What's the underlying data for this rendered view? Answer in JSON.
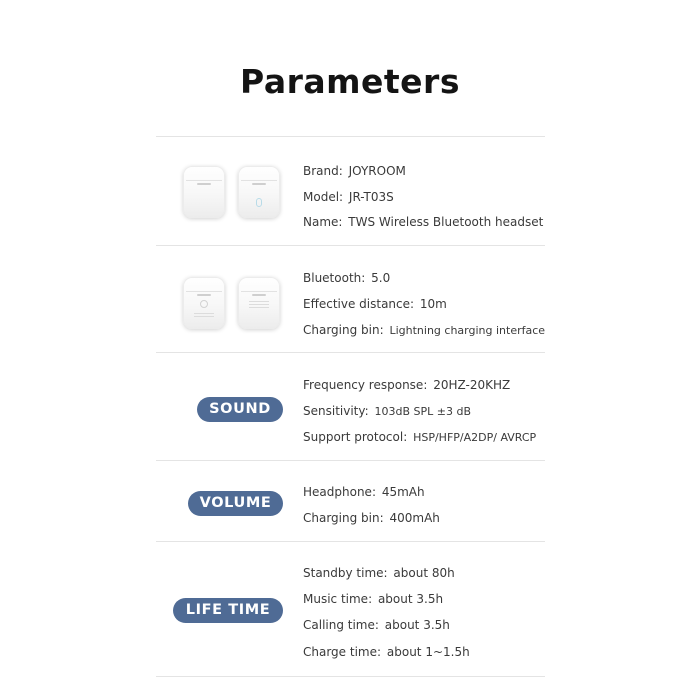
{
  "title": "Parameters",
  "sections": {
    "identity": {
      "rows": [
        {
          "label": "Brand",
          "sep": ":",
          "value": "JOYROOM"
        },
        {
          "label": "Model",
          "sep": ":",
          "value": "JR-T03S"
        },
        {
          "label": "Name",
          "sep": ":",
          "value": "TWS Wireless Bluetooth headset"
        }
      ]
    },
    "connectivity": {
      "rows": [
        {
          "label": "Bluetooth",
          "sep": ":",
          "value": "5.0"
        },
        {
          "label": "Effective distance",
          "sep": ":",
          "value": "10m"
        },
        {
          "label": "Charging bin",
          "sep": ":",
          "value": "Lightning charging interface"
        }
      ]
    },
    "sound": {
      "badge": "SOUND",
      "rows": [
        {
          "label": "Frequency response",
          "sep": ":",
          "value": "20HZ-20KHZ"
        },
        {
          "label": "Sensitivity",
          "sep": ":",
          "value": "103dB SPL ±3 dB"
        },
        {
          "label": "Support protocol",
          "sep": ":",
          "value": "HSP/HFP/A2DP/ AVRCP"
        }
      ]
    },
    "volume": {
      "badge": "VOLUME",
      "rows": [
        {
          "label": "Headphone",
          "sep": ":",
          "value": "45mAh"
        },
        {
          "label": "Charging bin",
          "sep": ":",
          "value": "400mAh"
        }
      ]
    },
    "life_time": {
      "badge": "LIFE TIME",
      "rows": [
        {
          "label": "Standby time",
          "sep": ":",
          "value": "about 80h"
        },
        {
          "label": "Music time",
          "sep": ":",
          "value": "about 3.5h"
        },
        {
          "label": "Calling time",
          "sep": ":",
          "value": "about 3.5h"
        },
        {
          "label": "Charge time",
          "sep": ":",
          "value": "about 1~1.5h"
        }
      ]
    }
  },
  "colors": {
    "badge_background": "#4f6b95",
    "title": "#141414",
    "text": "#3a3a3a",
    "divider": "#e4e4e4"
  }
}
